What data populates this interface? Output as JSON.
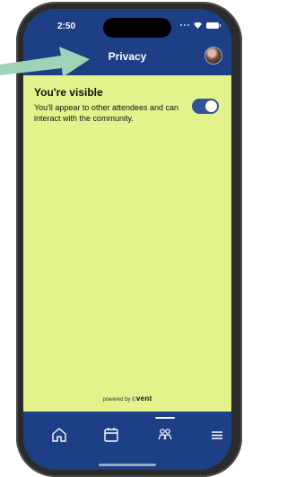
{
  "status_bar": {
    "time": "2:50"
  },
  "header": {
    "title": "Privacy",
    "avatar_icon": "user-avatar"
  },
  "privacy_setting": {
    "title": "You're visible",
    "description": "You'll appear to other attendees and can interact with the community.",
    "toggle_on": true
  },
  "footer": {
    "powered_by": "powered by",
    "brand_c": "c",
    "brand_rest": "vent"
  },
  "tab_bar": {
    "items": [
      {
        "icon": "home-icon"
      },
      {
        "icon": "calendar-icon"
      },
      {
        "icon": "people-icon",
        "active": true
      },
      {
        "icon": "menu-icon"
      }
    ]
  },
  "colors": {
    "nav_blue": "#1c3f85",
    "content_background": "#e3f28a",
    "toggle_on": "#2f5497",
    "pointer_arrow": "#9fd3b8"
  }
}
